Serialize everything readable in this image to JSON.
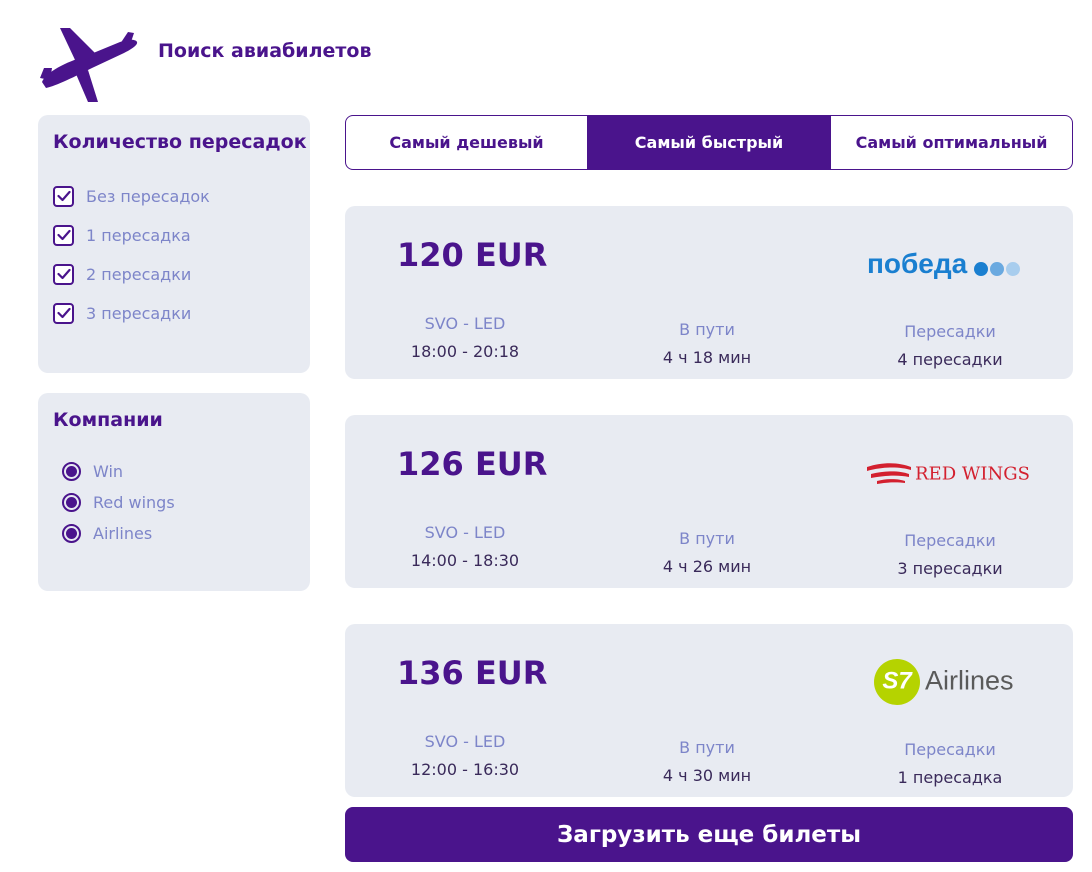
{
  "header": {
    "title": "Поиск авиабилетов",
    "logo_icon": "airplane-icon"
  },
  "stops_filter": {
    "title": "Количество пересадок",
    "options": [
      {
        "label": "Без пересадок",
        "checked": true
      },
      {
        "label": "1 пересадка",
        "checked": true
      },
      {
        "label": "2 пересадки",
        "checked": true
      },
      {
        "label": "3 пересадки",
        "checked": true
      }
    ]
  },
  "companies_filter": {
    "title": "Компании",
    "options": [
      {
        "label": "Win",
        "selected": true
      },
      {
        "label": "Red wings",
        "selected": true
      },
      {
        "label": "Airlines",
        "selected": true
      }
    ]
  },
  "sort_tabs": [
    {
      "label": "Самый дешевый",
      "active": false
    },
    {
      "label": "Самый быстрый",
      "active": true
    },
    {
      "label": "Самый оптимальный",
      "active": false
    }
  ],
  "tickets": [
    {
      "price": "120 EUR",
      "carrier": "победа",
      "route": "SVO - LED",
      "time": "18:00 - 20:18",
      "duration_label": "В пути",
      "duration": "4 ч 18 мин",
      "stops_label": "Пересадки",
      "stops": "4 пересадки"
    },
    {
      "price": "126 EUR",
      "carrier": "RED WINGS",
      "route": "SVO - LED",
      "time": "14:00 - 18:30",
      "duration_label": "В пути",
      "duration": "4 ч 26 мин",
      "stops_label": "Пересадки",
      "stops": "3 пересадки"
    },
    {
      "price": "136 EUR",
      "carrier": "S7 Airlines",
      "route": "SVO - LED",
      "time": "12:00 - 16:30",
      "duration_label": "В пути",
      "duration": "4 ч 30 мин",
      "stops_label": "Пересадки",
      "stops": "1 пересадка"
    }
  ],
  "load_more_label": "Загрузить еще билеты",
  "colors": {
    "primary": "#4a148c",
    "panel_bg": "#e8ebf2",
    "muted_text": "#7d85c9",
    "pobeda_blue": "#1a7fd0",
    "redwings_red": "#d3202f",
    "s7_green": "#b5d300"
  }
}
